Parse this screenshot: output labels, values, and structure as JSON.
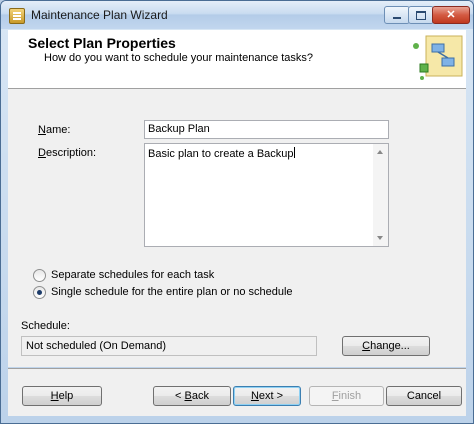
{
  "window": {
    "title": "Maintenance Plan Wizard"
  },
  "header": {
    "title": "Select Plan Properties",
    "subtitle": "How do you want to schedule your maintenance tasks?"
  },
  "form": {
    "name_label_underlined": "N",
    "name_label_rest": "ame:",
    "name_value": "Backup Plan",
    "description_label_underlined": "D",
    "description_label_rest": "escription:",
    "description_value": "Basic plan to create a Backup",
    "radio_separate": "Separate schedules for each task",
    "radio_single": "Single schedule for the entire plan or no schedule",
    "selected_option": "single",
    "schedule_label": "Schedule:",
    "schedule_value": "Not scheduled (On Demand)",
    "change_underlined": "C",
    "change_rest": "hange..."
  },
  "footer": {
    "help_underlined": "H",
    "help_rest": "elp",
    "back_prefix": "< ",
    "back_underlined": "B",
    "back_rest": "ack",
    "next_underlined": "N",
    "next_rest": "ext >",
    "finish_underlined": "F",
    "finish_rest": "inish",
    "cancel_label": "Cancel"
  },
  "icons": {
    "app": "wizard-app-icon",
    "header": "plan-diagram-icon"
  }
}
